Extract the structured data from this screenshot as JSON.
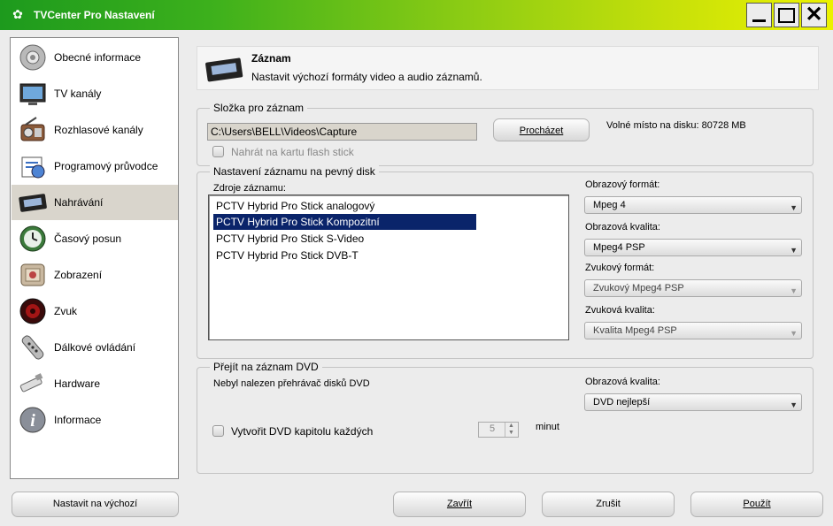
{
  "window": {
    "title": "TVCenter Pro Nastavení"
  },
  "sidebar": {
    "items": [
      {
        "label": "Obecné informace",
        "icon": "gear-icon"
      },
      {
        "label": "TV kanály",
        "icon": "tv-icon"
      },
      {
        "label": "Rozhlasové kanály",
        "icon": "radio-icon"
      },
      {
        "label": "Programový průvodce",
        "icon": "guide-icon"
      },
      {
        "label": "Nahrávání",
        "icon": "videotape-icon"
      },
      {
        "label": "Časový posun",
        "icon": "clock-icon"
      },
      {
        "label": "Zobrazení",
        "icon": "display-icon"
      },
      {
        "label": "Zvuk",
        "icon": "speaker-icon"
      },
      {
        "label": "Dálkové ovládání",
        "icon": "remote-icon"
      },
      {
        "label": "Hardware",
        "icon": "usb-stick-icon"
      },
      {
        "label": "Informace",
        "icon": "info-icon"
      }
    ],
    "selected": "Nahrávání"
  },
  "header": {
    "title": "Záznam",
    "subtitle": "Nastavit výchozí formáty video a audio záznamů."
  },
  "folder_group": {
    "legend": "Složka pro záznam",
    "path_value": "C:\\Users\\BELL\\Videos\\Capture",
    "browse_label": "Procházet",
    "free_space": "Volné místo na disku: 80728 MB",
    "flash_checkbox_label": "Nahrát na kartu flash stick",
    "flash_checked": false
  },
  "disk_group": {
    "legend": "Nastavení záznamu na pevný disk",
    "sources_label": "Zdroje záznamu:",
    "sources": [
      "PCTV Hybrid Pro Stick analogový",
      "PCTV Hybrid Pro Stick Kompozitní",
      "PCTV Hybrid Pro Stick S-Video",
      "PCTV Hybrid Pro Stick DVB-T"
    ],
    "selected_source": "PCTV Hybrid Pro Stick Kompozitní",
    "video_format_label": "Obrazový formát:",
    "video_format_value": "Mpeg 4",
    "video_quality_label": "Obrazová kvalita:",
    "video_quality_value": "Mpeg4 PSP",
    "audio_format_label": "Zvukový formát:",
    "audio_format_value": "Zvukový Mpeg4 PSP",
    "audio_quality_label": "Zvuková kvalita:",
    "audio_quality_value": "Kvalita Mpeg4 PSP"
  },
  "dvd_group": {
    "legend": "Přejít na záznam DVD",
    "status": "Nebyl nalezen přehrávač disků DVD",
    "quality_label": "Obrazová kvalita:",
    "quality_value": "DVD nejlepší",
    "chapter_label": "Vytvořit DVD kapitolu každých",
    "chapter_checked": false,
    "chapter_minutes": "5",
    "minutes_unit": "minut"
  },
  "footer": {
    "defaults_label": "Nastavit na výchozí",
    "close_label": "Zavřít",
    "cancel_label": "Zrušit",
    "apply_label": "Použít"
  },
  "colors": {
    "title_gradient_start": "#1d9a1d",
    "title_gradient_end": "#ecf200",
    "selection": "#0a246a",
    "sidebar_selected": "#d9d5cc"
  }
}
